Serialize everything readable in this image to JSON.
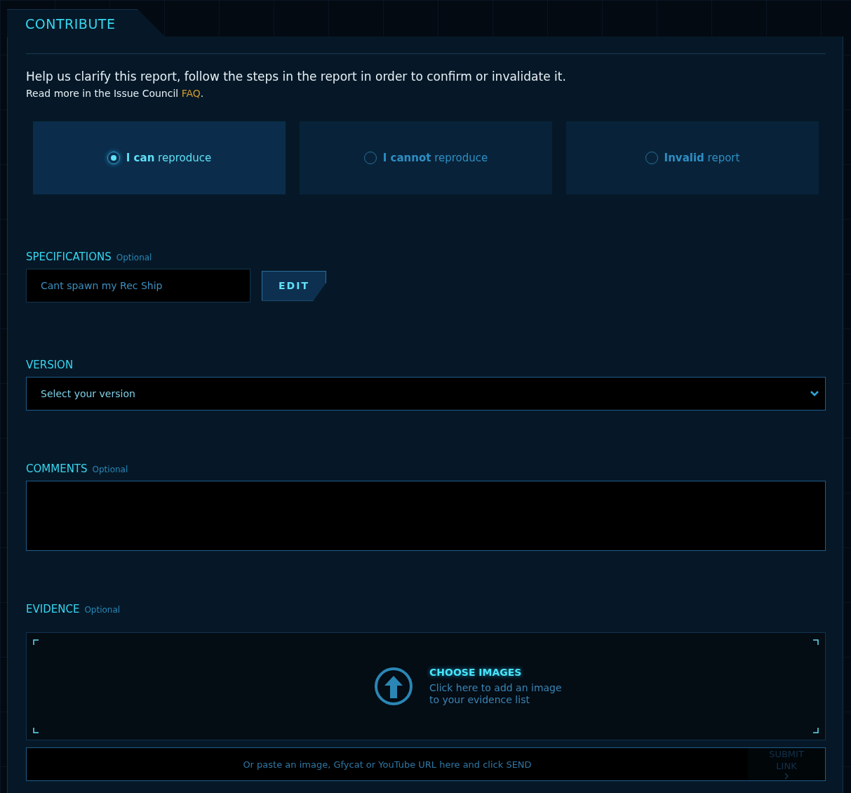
{
  "title": "CONTRIBUTE",
  "intro": "Help us clarify this report, follow the steps in the report in order to confirm or invalidate it.",
  "read_more": {
    "text": "Read more in the Issue Council",
    "link": "FAQ",
    "end": "."
  },
  "options": [
    {
      "label": "**I can** reproduce",
      "selected": true
    },
    {
      "label": "**I cannot** reproduce",
      "selected": false
    },
    {
      "label": "**Invalid** report",
      "selected": false
    }
  ],
  "specifications": {
    "label": "SPECIFICATIONS",
    "optional": "Optional",
    "value": "Cant spawn my Rec Ship",
    "button": "EDIT"
  },
  "version": {
    "label": "VERSION",
    "placeholder": "Select your version"
  },
  "comments": {
    "label": "COMMENTS",
    "optional": "Optional"
  },
  "evidence": {
    "label": "EVIDENCE",
    "optional": "Optional",
    "choose": "CHOOSE IMAGES",
    "hint": "Click here to add an image to your evidence list",
    "url_placeholder": "Or paste an image, Gfycat or YouTube URL here and click SEND",
    "submit": {
      "label": "SUBMIT LINK",
      "disabled": true
    }
  }
}
